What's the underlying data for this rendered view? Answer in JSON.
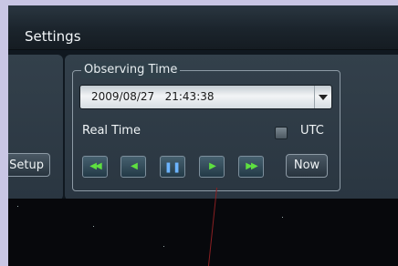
{
  "window": {
    "title": "Settings"
  },
  "observing_time": {
    "legend": "Observing Time",
    "datetime_value": "2009/08/27   21:43:38",
    "real_time_label": "Real Time",
    "utc_label": "UTC",
    "utc_checked": false,
    "now_label": "Now",
    "controls": [
      {
        "name": "fast-rewind-button",
        "glyph": "◀◀",
        "color": "green"
      },
      {
        "name": "rewind-button",
        "glyph": "◀",
        "color": "green"
      },
      {
        "name": "pause-button",
        "glyph": "❚❚",
        "color": "blue"
      },
      {
        "name": "play-button",
        "glyph": "▶",
        "color": "green"
      },
      {
        "name": "fast-forward-button",
        "glyph": "▶▶",
        "color": "green"
      }
    ]
  },
  "left_panel": {
    "setup_label": "Setup"
  }
}
